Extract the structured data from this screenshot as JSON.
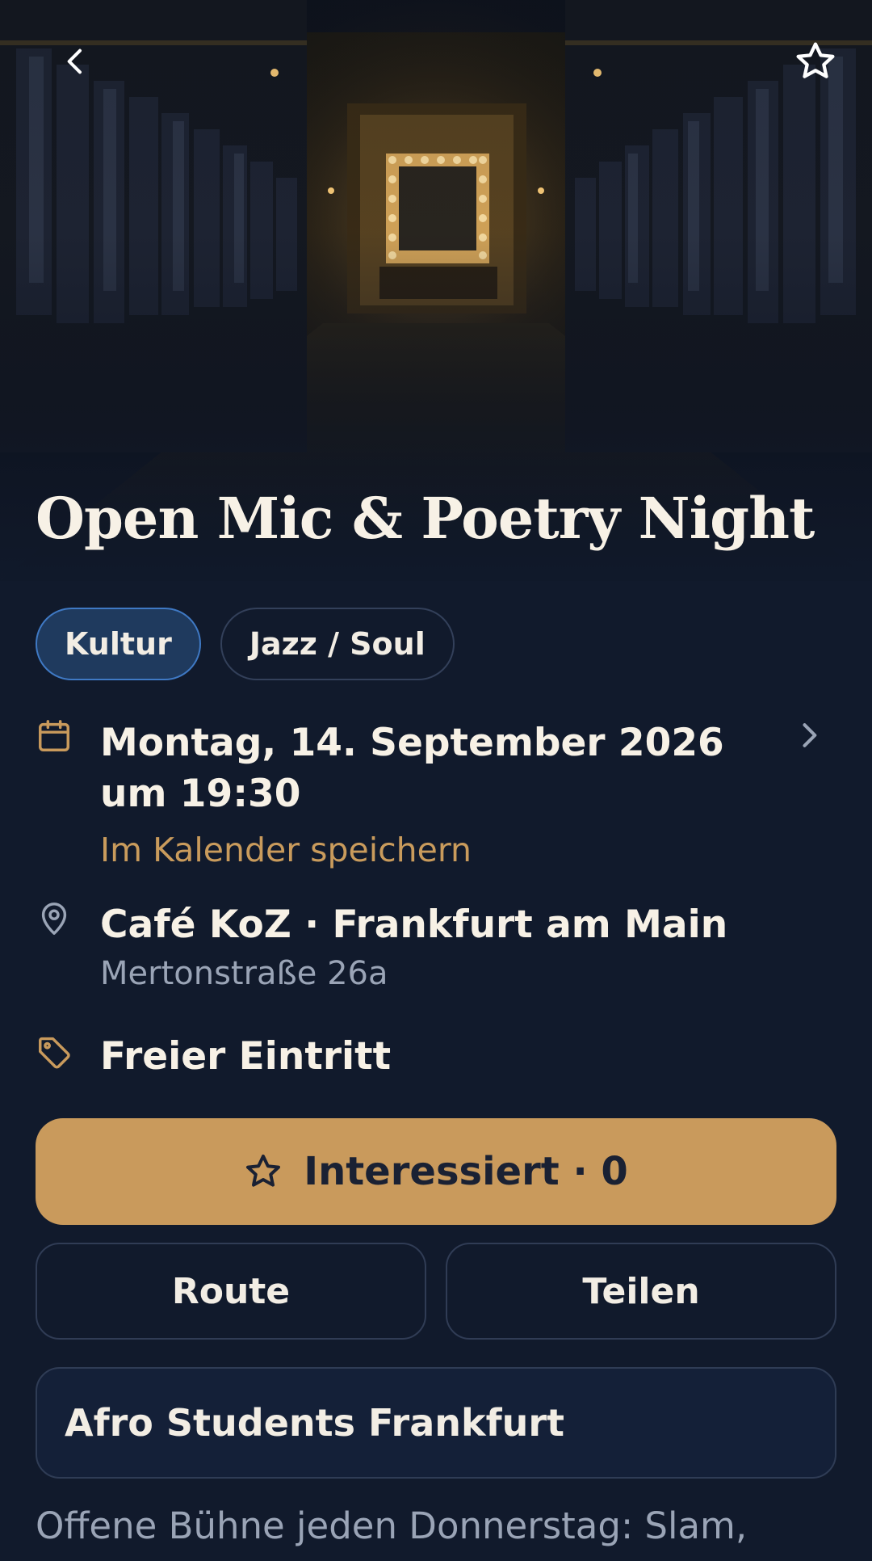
{
  "event": {
    "title": "Open Mic & Poetry Night",
    "tags": [
      "Kultur",
      "Jazz / Soul"
    ],
    "date_text": "Montag, 14. September 2026 um 19:30",
    "calendar_link": "Im Kalender speichern",
    "venue": "Café KoZ · Frankfurt am Main",
    "address": "Mertonstraße 26a",
    "price": "Freier Eintritt",
    "organizer": "Afro Students Frankfurt",
    "description": "Offene Bühne jeden Donnerstag: Slam,"
  },
  "actions": {
    "interested_label": "Interessiert · 0",
    "route_label": "Route",
    "share_label": "Teilen"
  },
  "icons": {
    "back": "chevron-left-icon",
    "favorite": "star-outline-icon",
    "date": "calendar-icon",
    "location": "map-pin-icon",
    "price": "tag-icon",
    "date_more": "chevron-right-icon",
    "interested": "star-outline-icon"
  },
  "colors": {
    "background": "#111a2c",
    "accent": "#c99a5c",
    "chip_active_bg": "#1f3a5e",
    "chip_active_border": "#3f79c4",
    "muted_text": "#9aa4b6"
  }
}
